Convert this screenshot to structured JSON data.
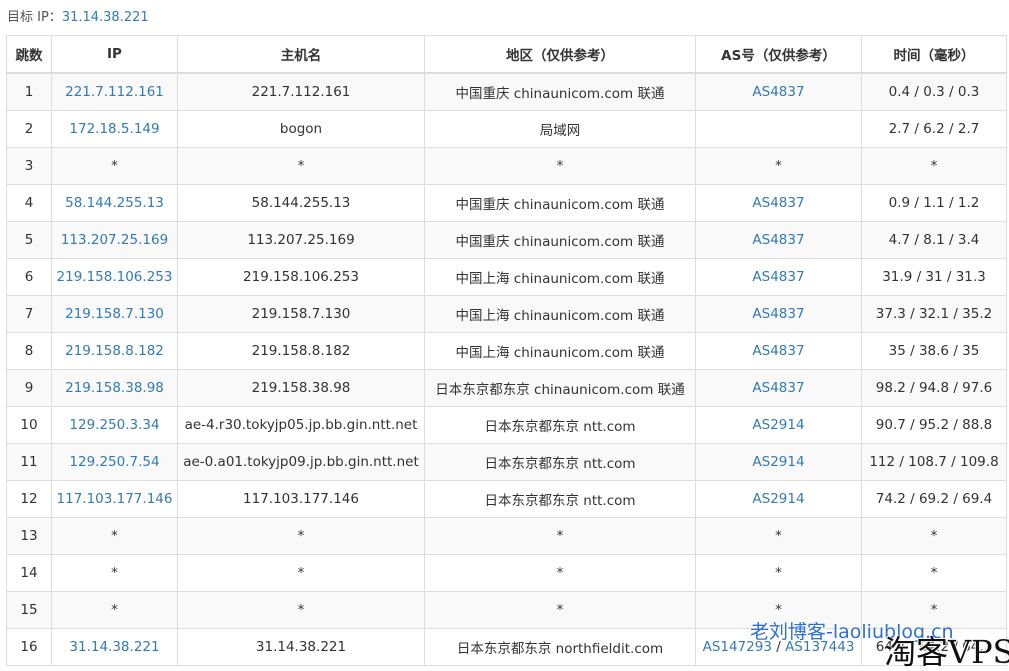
{
  "target": {
    "label": "目标 IP：",
    "ip": "31.14.38.221"
  },
  "headers": {
    "hop": "跳数",
    "ip": "IP",
    "host": "主机名",
    "region": "地区（仅供参考）",
    "asn": "AS号（仅供参考）",
    "time": "时间（毫秒）"
  },
  "rows": [
    {
      "hop": "1",
      "ip": "221.7.112.161",
      "host": "221.7.112.161",
      "region": "中国重庆 chinaunicom.com 联通",
      "asn": "AS4837",
      "asn2": "",
      "time": "0.4 / 0.3 / 0.3"
    },
    {
      "hop": "2",
      "ip": "172.18.5.149",
      "host": "bogon",
      "region": "局域网",
      "asn": "",
      "asn2": "",
      "time": "2.7 / 6.2 / 2.7"
    },
    {
      "hop": "3",
      "ip": "*",
      "host": "*",
      "region": "*",
      "asn": "*",
      "asn2": "",
      "time": "*"
    },
    {
      "hop": "4",
      "ip": "58.144.255.13",
      "host": "58.144.255.13",
      "region": "中国重庆 chinaunicom.com 联通",
      "asn": "AS4837",
      "asn2": "",
      "time": "0.9 / 1.1 / 1.2"
    },
    {
      "hop": "5",
      "ip": "113.207.25.169",
      "host": "113.207.25.169",
      "region": "中国重庆 chinaunicom.com 联通",
      "asn": "AS4837",
      "asn2": "",
      "time": "4.7 / 8.1 / 3.4"
    },
    {
      "hop": "6",
      "ip": "219.158.106.253",
      "host": "219.158.106.253",
      "region": "中国上海 chinaunicom.com 联通",
      "asn": "AS4837",
      "asn2": "",
      "time": "31.9 / 31 / 31.3"
    },
    {
      "hop": "7",
      "ip": "219.158.7.130",
      "host": "219.158.7.130",
      "region": "中国上海 chinaunicom.com 联通",
      "asn": "AS4837",
      "asn2": "",
      "time": "37.3 / 32.1 / 35.2"
    },
    {
      "hop": "8",
      "ip": "219.158.8.182",
      "host": "219.158.8.182",
      "region": "中国上海 chinaunicom.com 联通",
      "asn": "AS4837",
      "asn2": "",
      "time": "35 / 38.6 / 35"
    },
    {
      "hop": "9",
      "ip": "219.158.38.98",
      "host": "219.158.38.98",
      "region": "日本东京都东京 chinaunicom.com 联通",
      "asn": "AS4837",
      "asn2": "",
      "time": "98.2 / 94.8 / 97.6"
    },
    {
      "hop": "10",
      "ip": "129.250.3.34",
      "host": "ae-4.r30.tokyjp05.jp.bb.gin.ntt.net",
      "region": "日本东京都东京 ntt.com",
      "asn": "AS2914",
      "asn2": "",
      "time": "90.7 / 95.2 / 88.8"
    },
    {
      "hop": "11",
      "ip": "129.250.7.54",
      "host": "ae-0.a01.tokyjp09.jp.bb.gin.ntt.net",
      "region": "日本东京都东京 ntt.com",
      "asn": "AS2914",
      "asn2": "",
      "time": "112 / 108.7 / 109.8"
    },
    {
      "hop": "12",
      "ip": "117.103.177.146",
      "host": "117.103.177.146",
      "region": "日本东京都东京 ntt.com",
      "asn": "AS2914",
      "asn2": "",
      "time": "74.2 / 69.2 / 69.4"
    },
    {
      "hop": "13",
      "ip": "*",
      "host": "*",
      "region": "*",
      "asn": "*",
      "asn2": "",
      "time": "*"
    },
    {
      "hop": "14",
      "ip": "*",
      "host": "*",
      "region": "*",
      "asn": "*",
      "asn2": "",
      "time": "*"
    },
    {
      "hop": "15",
      "ip": "*",
      "host": "*",
      "region": "*",
      "asn": "*",
      "asn2": "",
      "time": "*"
    },
    {
      "hop": "16",
      "ip": "31.14.38.221",
      "host": "31.14.38.221",
      "region": "日本东京都东京 northfieldit.com",
      "asn": "AS147293",
      "asn2": "AS137443",
      "time": "64.7 / 64.2 / 64.2"
    }
  ],
  "asn_separator": " / ",
  "watermarks": {
    "blog": "老刘博客-laoliublog.cn",
    "brand": "淘客VPS"
  },
  "colors": {
    "link": "#337ab7",
    "stripe": "#f9f9f9",
    "border": "#dddddd"
  }
}
